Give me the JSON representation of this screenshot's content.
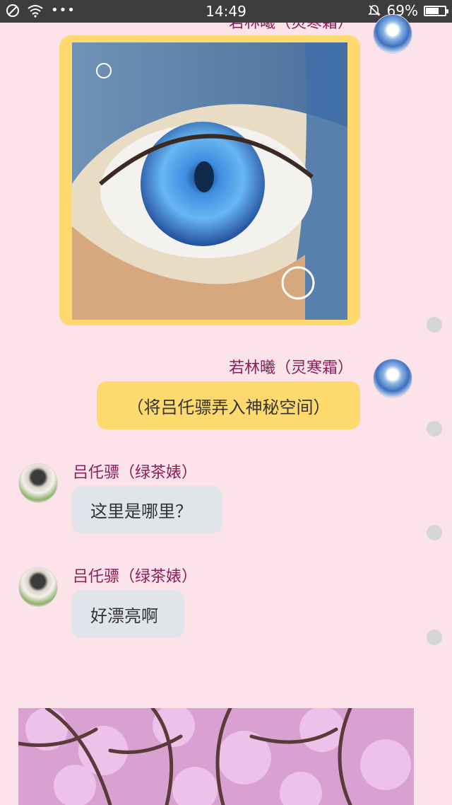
{
  "status_bar": {
    "time": "14:49",
    "battery_percent": "69%",
    "battery_level": 0.69
  },
  "messages": [
    {
      "sender": "若林曦（灵寒霜）",
      "side": "right",
      "type": "image",
      "image_description": "anime eye close-up"
    },
    {
      "sender": "若林曦（灵寒霜）",
      "side": "right",
      "type": "text",
      "text": "（将吕仛骠弄入神秘空间）"
    },
    {
      "sender": "吕仛骠（绿茶婊）",
      "side": "left",
      "type": "text",
      "text": "这里是哪里？"
    },
    {
      "sender": "吕仛骠（绿茶婊）",
      "side": "left",
      "type": "text",
      "text": "好漂亮啊"
    },
    {
      "type": "image",
      "side": "left",
      "image_description": "pink cherry blossom trees"
    }
  ],
  "colors": {
    "background": "#fbe3e9",
    "self_bubble": "#fed96e",
    "other_bubble": "#e1e5ea",
    "name": "#8c1d58"
  }
}
